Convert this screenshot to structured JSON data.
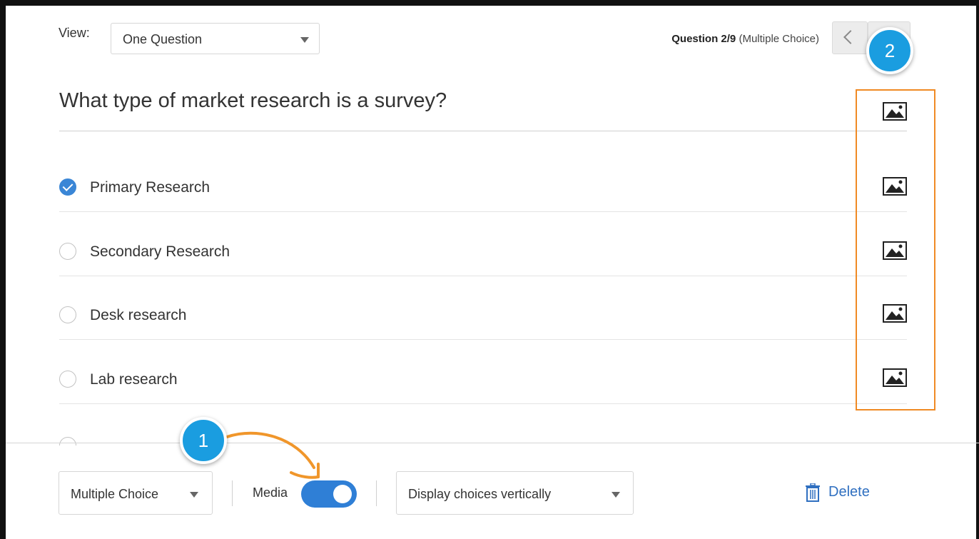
{
  "header": {
    "view_label": "View:",
    "view_selected": "One Question",
    "question_counter": "Question 2/9",
    "question_type_note": "(Multiple Choice)"
  },
  "question": {
    "title": "What type of market research is a survey?",
    "choices": [
      {
        "label": "Primary Research",
        "selected": true
      },
      {
        "label": "Secondary Research",
        "selected": false
      },
      {
        "label": "Desk research",
        "selected": false
      },
      {
        "label": "Lab research",
        "selected": false
      }
    ]
  },
  "toolbar": {
    "question_type": "Multiple Choice",
    "media_label": "Media",
    "media_enabled": true,
    "display_mode": "Display choices vertically",
    "delete_label": "Delete"
  },
  "annotations": {
    "badge_1": "1",
    "badge_2": "2",
    "highlight_color": "#f08a24",
    "badge_color": "#1a9de0"
  },
  "colors": {
    "accent": "#2f7fd6",
    "link": "#2f6fc0"
  },
  "icons": {
    "media": "image-icon",
    "delete": "trash-icon",
    "prev": "chevron-left-icon",
    "dropdown": "caret-down-icon"
  }
}
